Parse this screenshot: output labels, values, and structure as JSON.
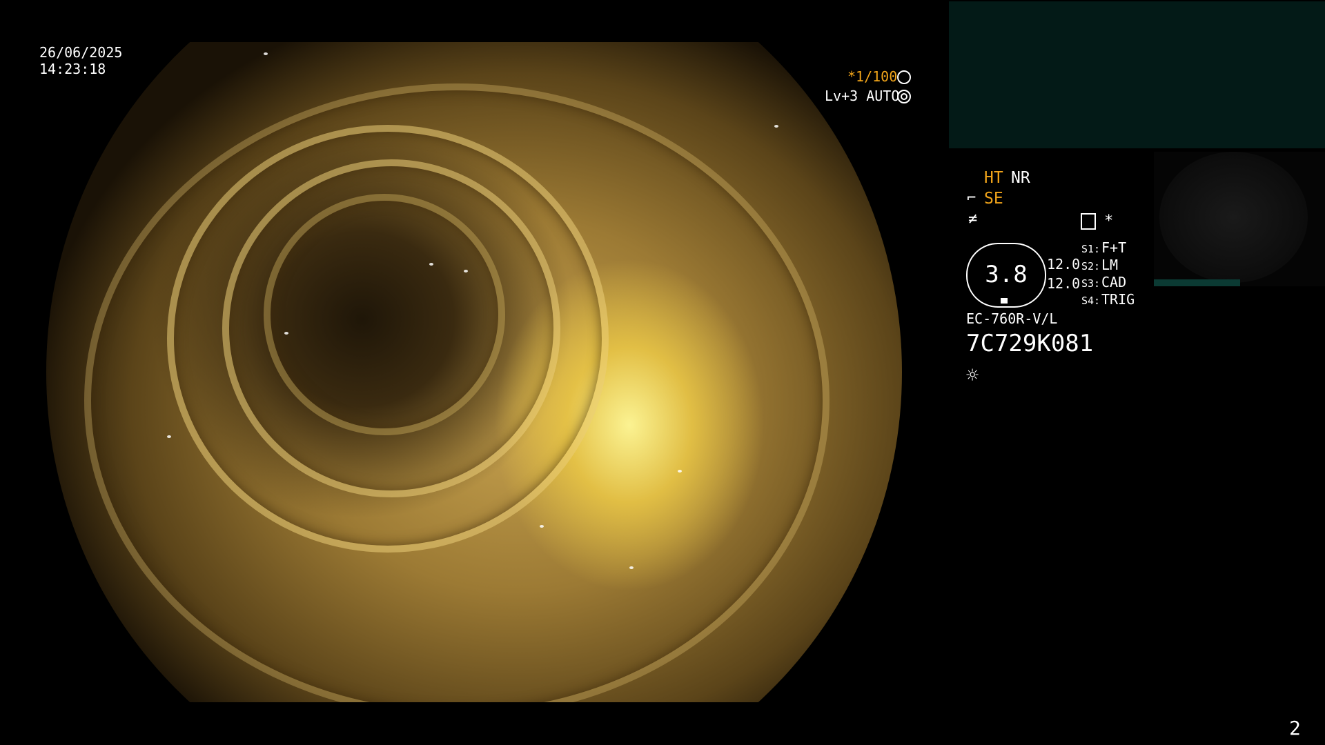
{
  "overlay": {
    "date": "26/06/2025",
    "time": "14:23:18",
    "shutter": "*1/100",
    "shutter_icon": "aperture-icon",
    "level": "Lv+3 AUTO",
    "level_icon": "iris-icon"
  },
  "settings": {
    "ht": "HT",
    "nr": "NR",
    "se": "SE",
    "s1_key": "S1:",
    "s1_val": "F+T",
    "s2_key": "S2:",
    "s2_val": "LM",
    "s3_key": "S3:",
    "s3_val": "CAD",
    "s4_key": "S4:",
    "s4_val": "TRIG"
  },
  "dial": {
    "value": "3.8",
    "side_top": "12.0",
    "side_bottom": "12.0"
  },
  "scope_model": "EC-760R-V/L",
  "serial": "7C729K081",
  "page_number": "2",
  "colors": {
    "accent": "#f2a51a",
    "panel": "#031a17"
  }
}
